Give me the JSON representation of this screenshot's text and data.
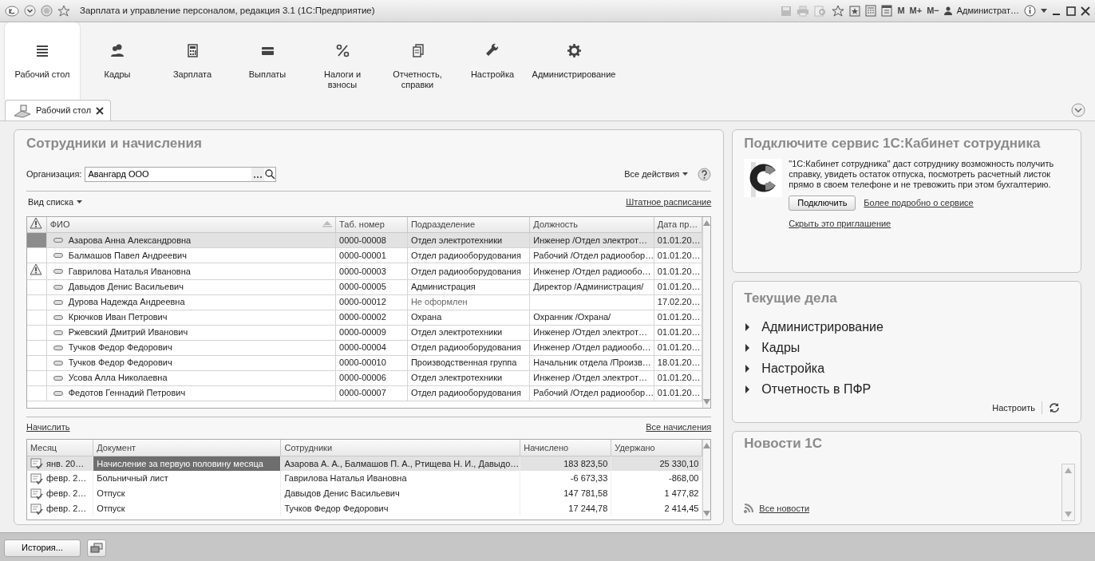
{
  "window": {
    "title": "Зарплата и управление персоналом, редакция 3.1  (1С:Предприятие)",
    "memory_buttons": [
      "M",
      "M+",
      "M−"
    ],
    "user": "Администрат…"
  },
  "sections": [
    {
      "label": "Рабочий стол",
      "kind": "menu",
      "selected": true
    },
    {
      "label": "Кадры",
      "kind": "people",
      "selected": false
    },
    {
      "label": "Зарплата",
      "kind": "calculator",
      "selected": false
    },
    {
      "label": "Выплаты",
      "kind": "card",
      "selected": false
    },
    {
      "label": "Налоги и взносы",
      "kind": "percent",
      "selected": false
    },
    {
      "label": "Отчетность, справки",
      "kind": "documents",
      "selected": false
    },
    {
      "label": "Настройка",
      "kind": "wrench",
      "selected": false
    },
    {
      "label": "Администрирование",
      "kind": "gear",
      "selected": false
    }
  ],
  "open_tabs": [
    {
      "label": "Рабочий стол",
      "selected": true
    }
  ],
  "employees": {
    "title": "Сотрудники и начисления",
    "org_label": "Организация:",
    "org_value": "Авангард ООО",
    "all_actions": "Все действия",
    "view_list": "Вид списка",
    "staff_link": "Штатное расписание",
    "columns": [
      "ФИО",
      "Таб. номер",
      "Подразделение",
      "Должность",
      "Дата пр…"
    ],
    "rows": [
      {
        "warning": false,
        "selected": true,
        "hired": true,
        "cells": [
          "Азарова Анна Александровна",
          "0000-00008",
          "Отдел электротехники",
          "Инженер /Отдел электрот…",
          "01.01.20…"
        ]
      },
      {
        "warning": false,
        "selected": false,
        "hired": true,
        "cells": [
          "Балмашов Павел Андреевич",
          "0000-00001",
          "Отдел радиооборудования",
          "Рабочий /Отдел радиообор…",
          "01.01.20…"
        ]
      },
      {
        "warning": true,
        "selected": false,
        "hired": true,
        "cells": [
          "Гаврилова Наталья Ивановна",
          "0000-00003",
          "Отдел радиооборудования",
          "Инженер /Отдел радиообо…",
          "01.01.20…"
        ]
      },
      {
        "warning": false,
        "selected": false,
        "hired": true,
        "cells": [
          "Давыдов Денис Васильевич",
          "0000-00005",
          "Администрация",
          "Директор /Администрация/",
          "01.01.20…"
        ]
      },
      {
        "warning": false,
        "selected": false,
        "hired": false,
        "cells": [
          "Дурова Надежда Андреевна",
          "0000-00012",
          "Не оформлен",
          "",
          "17.02.20…"
        ]
      },
      {
        "warning": false,
        "selected": false,
        "hired": true,
        "cells": [
          "Крючков Иван Петрович",
          "0000-00002",
          "Охрана",
          "Охранник /Охрана/",
          "01.01.20…"
        ]
      },
      {
        "warning": false,
        "selected": false,
        "hired": true,
        "cells": [
          "Ржевский Дмитрий Иванович",
          "0000-00009",
          "Отдел электротехники",
          "Инженер /Отдел электрот…",
          "01.01.20…"
        ]
      },
      {
        "warning": false,
        "selected": false,
        "hired": true,
        "cells": [
          "Тучков Федор Федорович",
          "0000-00004",
          "Отдел радиооборудования",
          "Инженер /Отдел радиообо…",
          "01.01.20…"
        ]
      },
      {
        "warning": false,
        "selected": false,
        "hired": true,
        "cells": [
          "Тучков Федор Федорович",
          "0000-00010",
          "Производственная группа",
          "Начальник отдела /Произв…",
          "18.01.20…"
        ]
      },
      {
        "warning": false,
        "selected": false,
        "hired": true,
        "cells": [
          "Усова Алла Николаевна",
          "0000-00006",
          "Отдел электротехники",
          "Инженер /Отдел электрот…",
          "01.01.20…"
        ]
      },
      {
        "warning": false,
        "selected": false,
        "hired": true,
        "cells": [
          "Федотов Геннадий Петрович",
          "0000-00007",
          "Отдел радиооборудования",
          "Рабочий /Отдел радиообор…",
          "01.01.20…"
        ]
      }
    ]
  },
  "accruals": {
    "accrue_link": "Начислить",
    "all_link": "Все начисления",
    "columns": [
      "Месяц",
      "Документ",
      "Сотрудники",
      "Начислено",
      "Удержано"
    ],
    "rows": [
      {
        "selected": true,
        "cells": [
          "янв. 20…",
          "Начисление за первую половину месяца",
          "Азарова А. А., Балмашов П. А., Ртищева Н. И., Давыдо…",
          "183 823,50",
          "25 330,10"
        ]
      },
      {
        "selected": false,
        "cells": [
          "февр. 2…",
          "Больничный лист",
          "Гаврилова Наталья Ивановна",
          "-6 673,33",
          "-868,00"
        ]
      },
      {
        "selected": false,
        "cells": [
          "февр. 2…",
          "Отпуск",
          "Давыдов Денис Васильевич",
          "147 781,58",
          "1 477,82"
        ]
      },
      {
        "selected": false,
        "cells": [
          "февр. 2…",
          "Отпуск",
          "Тучков Федор Федорович",
          "17 244,78",
          "2 414,45"
        ]
      }
    ]
  },
  "cabinet": {
    "title": "Подключите сервис 1С:Кабинет сотрудника",
    "text": "\"1С:Кабинет сотрудника\" даст сотруднику возможность получить справку, увидеть остаток отпуска, посмотреть расчетный листок прямо в своем телефоне и не тревожить при этом бухгалтерию.",
    "connect_button": "Подключить",
    "more_link": "Более подробно о сервисе",
    "hide_link": "Скрыть это приглашение"
  },
  "tasks": {
    "title": "Текущие дела",
    "items": [
      {
        "label": "Администрирование",
        "expanded": false
      },
      {
        "label": "Кадры",
        "expanded": false
      },
      {
        "label": "Настройка",
        "expanded": false
      },
      {
        "label": "Отчетность в ПФР",
        "expanded": false
      }
    ],
    "configure": "Настроить"
  },
  "news": {
    "title": "Новости 1С",
    "all_link": "Все новости"
  },
  "status_bar": {
    "history_button": "История..."
  }
}
